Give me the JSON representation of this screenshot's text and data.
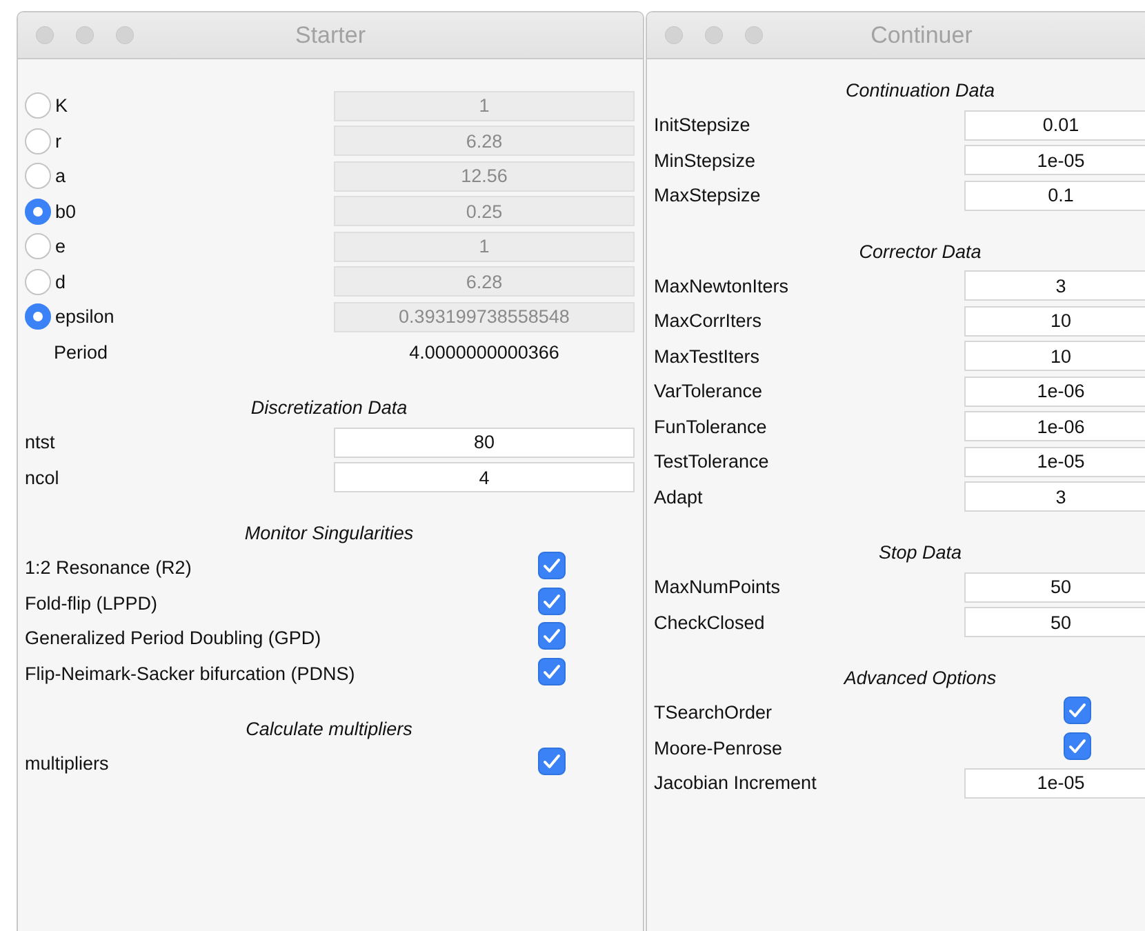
{
  "windows": [
    {
      "title": "Starter",
      "parameters": [
        {
          "label": "K",
          "selected": false,
          "value": "1",
          "disabled": true
        },
        {
          "label": "r",
          "selected": false,
          "value": "6.28",
          "disabled": true
        },
        {
          "label": "a",
          "selected": false,
          "value": "12.56",
          "disabled": true
        },
        {
          "label": "b0",
          "selected": true,
          "value": "0.25",
          "disabled": true
        },
        {
          "label": "e",
          "selected": false,
          "value": "1",
          "disabled": true
        },
        {
          "label": "d",
          "selected": false,
          "value": "6.28",
          "disabled": true
        },
        {
          "label": "epsilon",
          "selected": true,
          "value": "0.393199738558548",
          "disabled": true
        }
      ],
      "period": {
        "label": "Period",
        "value": "4.0000000000366"
      },
      "sections": [
        {
          "title": "Discretization Data",
          "rows": [
            {
              "kind": "field",
              "label": "ntst",
              "value": "80"
            },
            {
              "kind": "field",
              "label": "ncol",
              "value": "4"
            }
          ]
        },
        {
          "title": "Monitor Singularities",
          "rows": [
            {
              "kind": "check",
              "label": "1:2 Resonance (R2)",
              "checked": true
            },
            {
              "kind": "check",
              "label": "Fold-flip (LPPD)",
              "checked": true
            },
            {
              "kind": "check",
              "label": "Generalized Period Doubling (GPD)",
              "checked": true
            },
            {
              "kind": "check",
              "label": "Flip-Neimark-Sacker bifurcation (PDNS)",
              "checked": true
            }
          ]
        },
        {
          "title": "Calculate multipliers",
          "rows": [
            {
              "kind": "check",
              "label": "multipliers",
              "checked": true
            }
          ]
        }
      ]
    },
    {
      "title": "Continuer",
      "sections": [
        {
          "title": "Continuation Data",
          "rows": [
            {
              "kind": "field",
              "label": "InitStepsize",
              "value": "0.01"
            },
            {
              "kind": "field",
              "label": "MinStepsize",
              "value": "1e-05"
            },
            {
              "kind": "field",
              "label": "MaxStepsize",
              "value": "0.1"
            }
          ]
        },
        {
          "title": "Corrector Data",
          "rows": [
            {
              "kind": "field",
              "label": "MaxNewtonIters",
              "value": "3"
            },
            {
              "kind": "field",
              "label": "MaxCorrIters",
              "value": "10"
            },
            {
              "kind": "field",
              "label": "MaxTestIters",
              "value": "10"
            },
            {
              "kind": "field",
              "label": "VarTolerance",
              "value": "1e-06"
            },
            {
              "kind": "field",
              "label": "FunTolerance",
              "value": "1e-06"
            },
            {
              "kind": "field",
              "label": "TestTolerance",
              "value": "1e-05"
            },
            {
              "kind": "field",
              "label": "Adapt",
              "value": "3"
            }
          ]
        },
        {
          "title": "Stop Data",
          "rows": [
            {
              "kind": "field",
              "label": "MaxNumPoints",
              "value": "50"
            },
            {
              "kind": "field",
              "label": "CheckClosed",
              "value": "50"
            }
          ]
        },
        {
          "title": "Advanced Options",
          "rows": [
            {
              "kind": "check",
              "label": "TSearchOrder",
              "checked": true
            },
            {
              "kind": "check",
              "label": "Moore-Penrose",
              "checked": true
            },
            {
              "kind": "field",
              "label": "Jacobian Increment",
              "value": "1e-05"
            }
          ]
        }
      ]
    }
  ]
}
